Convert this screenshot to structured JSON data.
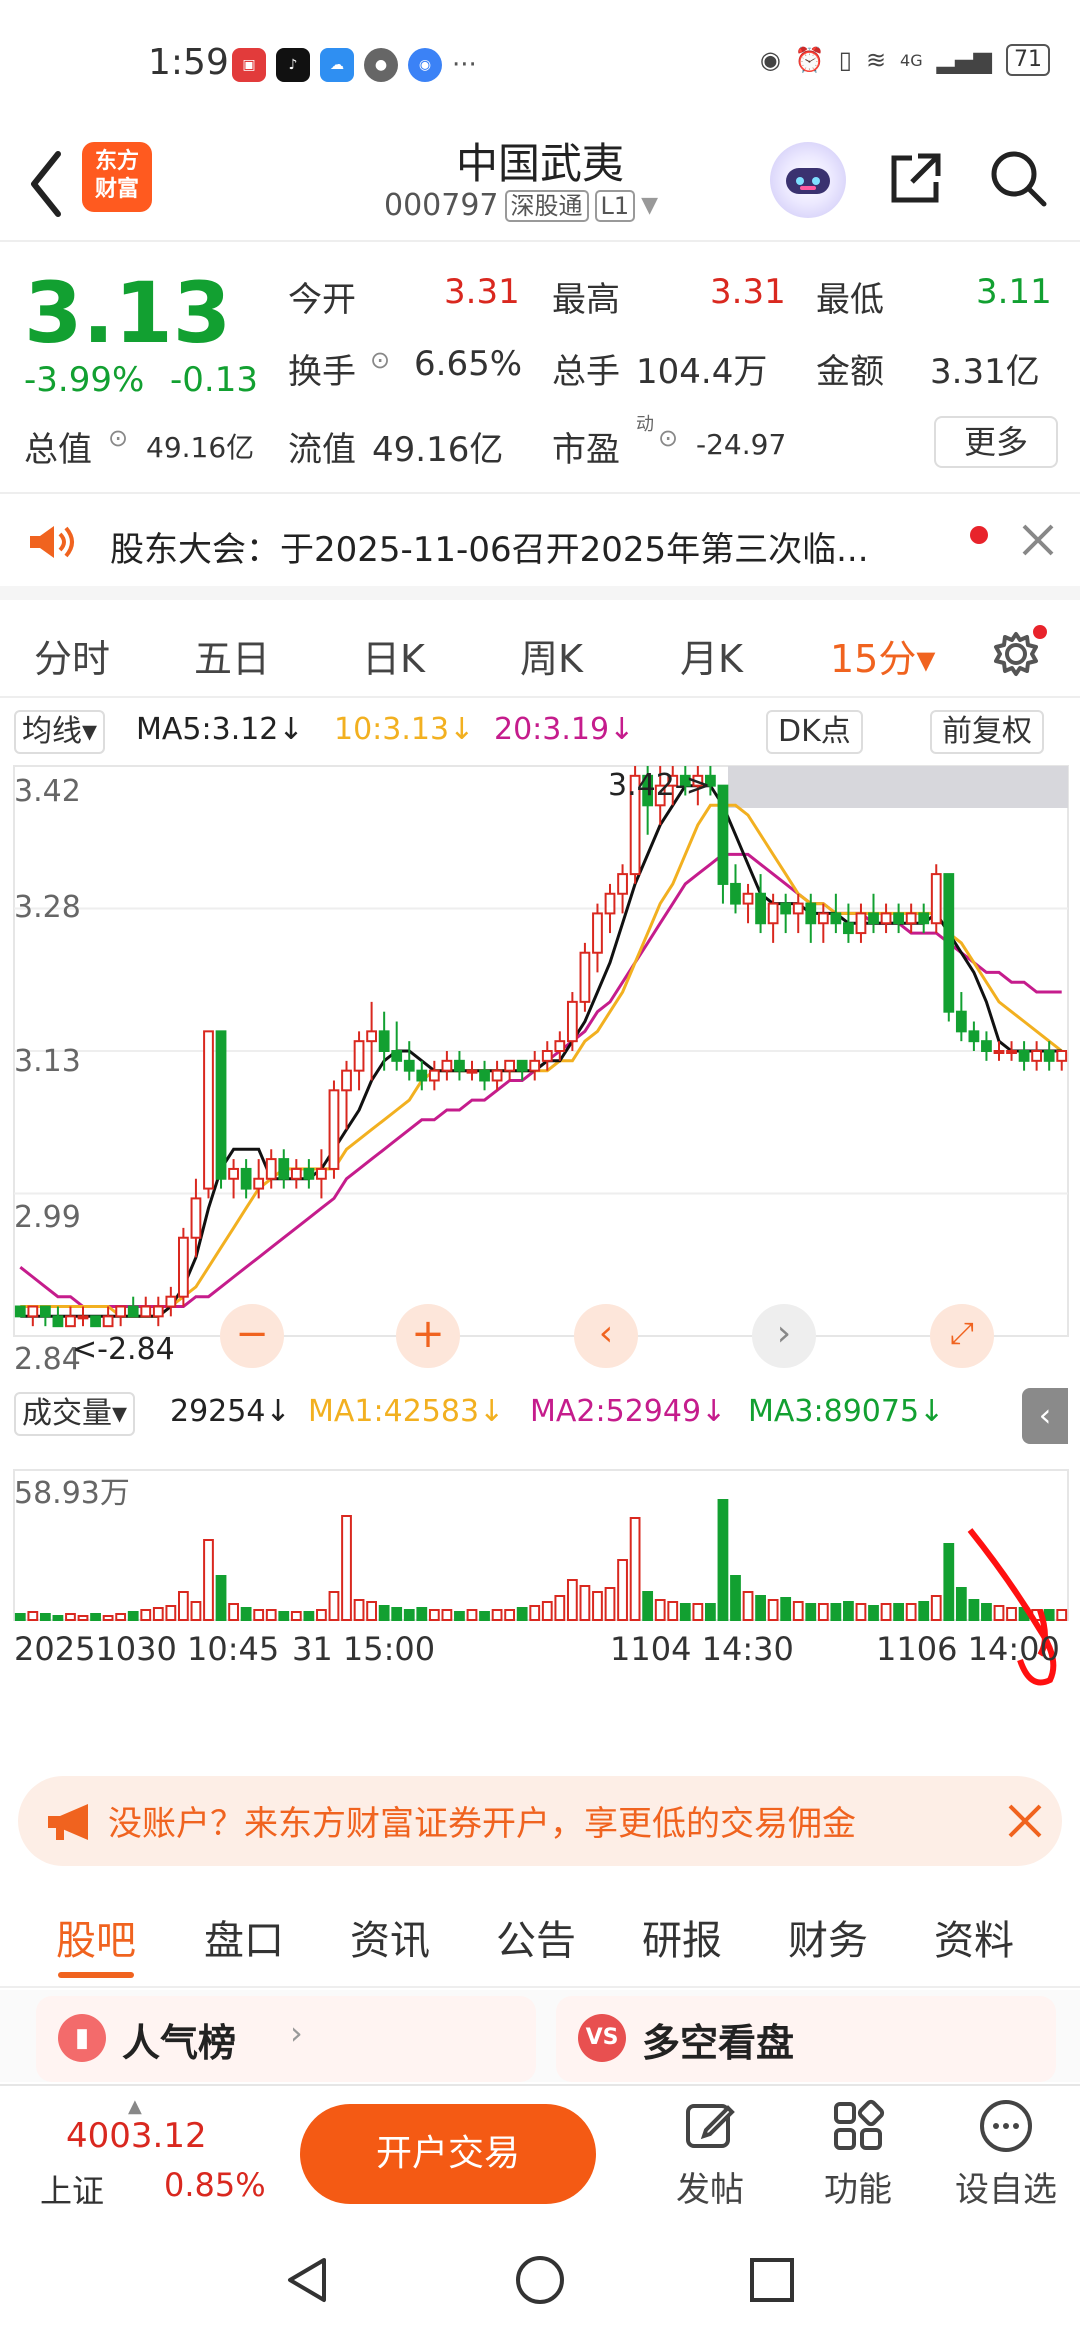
{
  "status_bar": {
    "time": "1:59",
    "network": "4G",
    "battery": "71"
  },
  "header": {
    "logo_line1": "东方",
    "logo_line2": "财富",
    "title": "中国武夷",
    "code": "000797",
    "tag1": "深股通",
    "tag2": "L1"
  },
  "quote": {
    "price": "3.13",
    "pct": "-3.99%",
    "change": "-0.13",
    "open_label": "今开",
    "open": "3.31",
    "high_label": "最高",
    "high": "3.31",
    "low_label": "最低",
    "low": "3.11",
    "turnover_label": "换手",
    "turnover": "6.65%",
    "volume_label": "总手",
    "volume": "104.4万",
    "amount_label": "金额",
    "amount": "3.31亿",
    "total_mv_label": "总值",
    "total_mv": "49.16亿",
    "float_mv_label": "流值",
    "float_mv": "49.16亿",
    "pe_label": "市盈",
    "pe_sup": "动",
    "pe": "-24.97",
    "more": "更多"
  },
  "notice": {
    "text": "股东大会：于2025-11-06召开2025年第三次临..."
  },
  "chart_tabs": [
    {
      "label": "分时"
    },
    {
      "label": "五日"
    },
    {
      "label": "日K"
    },
    {
      "label": "周K"
    },
    {
      "label": "月K"
    },
    {
      "label": "15分▾"
    }
  ],
  "ma_bar": {
    "selector": "均线▾",
    "ma5": "MA5:3.12↓",
    "ma10": "10:3.13↓",
    "ma20": "20:3.19↓",
    "dk": "DK点",
    "fq": "前复权"
  },
  "price_axis": [
    "3.42",
    "3.28",
    "3.13",
    "2.99",
    "2.84"
  ],
  "max_label": "3.42->",
  "min_label": "<-2.84",
  "vol_bar": {
    "selector": "成交量▾",
    "vol": "29254↓",
    "ma1": "MA1:42583↓",
    "ma2": "MA2:52949↓",
    "ma3": "MA3:89075↓"
  },
  "vol_axis": "58.93万",
  "time_axis": [
    "20251030 10:45",
    "31 15:00",
    "1104 14:30",
    "1106 14:00"
  ],
  "banner": {
    "text": "没账户？来东方财富证券开户，享更低的交易佣金"
  },
  "subtabs": [
    {
      "label": "股吧"
    },
    {
      "label": "盘口"
    },
    {
      "label": "资讯"
    },
    {
      "label": "公告"
    },
    {
      "label": "研报"
    },
    {
      "label": "财务"
    },
    {
      "label": "资料"
    }
  ],
  "cards": {
    "left": "人气榜",
    "right": "多空看盘"
  },
  "bottom": {
    "index_value": "4003.12",
    "index_name": "上证",
    "index_pct": "0.85%",
    "trade": "开户交易",
    "post": "发帖",
    "func": "功能",
    "watch": "设自选"
  },
  "colors": {
    "up": "#d9281f",
    "down": "#12a031",
    "accent": "#f0631f",
    "ma5": "#111111",
    "ma10": "#f2b020",
    "ma20": "#c51c8c"
  },
  "chart_data": {
    "type": "candlestick",
    "ylim": [
      2.84,
      3.42
    ],
    "candles": [
      [
        2.87,
        2.87,
        2.86,
        2.86
      ],
      [
        2.86,
        2.87,
        2.85,
        2.87
      ],
      [
        2.87,
        2.87,
        2.85,
        2.86
      ],
      [
        2.86,
        2.87,
        2.85,
        2.85
      ],
      [
        2.85,
        2.87,
        2.85,
        2.86
      ],
      [
        2.86,
        2.87,
        2.85,
        2.86
      ],
      [
        2.86,
        2.86,
        2.85,
        2.85
      ],
      [
        2.85,
        2.87,
        2.85,
        2.86
      ],
      [
        2.86,
        2.87,
        2.85,
        2.87
      ],
      [
        2.87,
        2.88,
        2.86,
        2.86
      ],
      [
        2.86,
        2.88,
        2.86,
        2.87
      ],
      [
        2.86,
        2.88,
        2.85,
        2.87
      ],
      [
        2.87,
        2.89,
        2.86,
        2.88
      ],
      [
        2.88,
        2.95,
        2.87,
        2.94
      ],
      [
        2.94,
        3.0,
        2.92,
        2.98
      ],
      [
        2.99,
        3.15,
        2.98,
        3.15
      ],
      [
        3.15,
        3.15,
        2.99,
        3.0
      ],
      [
        3.0,
        3.02,
        2.98,
        3.01
      ],
      [
        3.01,
        3.02,
        2.98,
        2.99
      ],
      [
        2.99,
        3.02,
        2.98,
        3.0
      ],
      [
        3.0,
        3.03,
        2.99,
        3.02
      ],
      [
        3.02,
        3.03,
        2.99,
        3.0
      ],
      [
        3.0,
        3.02,
        2.99,
        3.01
      ],
      [
        3.01,
        3.02,
        2.99,
        3.0
      ],
      [
        3.0,
        3.03,
        2.98,
        3.01
      ],
      [
        3.01,
        3.1,
        3.0,
        3.09
      ],
      [
        3.09,
        3.12,
        3.05,
        3.11
      ],
      [
        3.11,
        3.15,
        3.09,
        3.14
      ],
      [
        3.14,
        3.18,
        3.1,
        3.15
      ],
      [
        3.15,
        3.17,
        3.11,
        3.13
      ],
      [
        3.13,
        3.16,
        3.11,
        3.12
      ],
      [
        3.12,
        3.14,
        3.1,
        3.11
      ],
      [
        3.11,
        3.12,
        3.09,
        3.1
      ],
      [
        3.1,
        3.12,
        3.09,
        3.11
      ],
      [
        3.11,
        3.13,
        3.1,
        3.12
      ],
      [
        3.12,
        3.13,
        3.1,
        3.11
      ],
      [
        3.11,
        3.12,
        3.1,
        3.11
      ],
      [
        3.11,
        3.12,
        3.09,
        3.1
      ],
      [
        3.1,
        3.12,
        3.09,
        3.11
      ],
      [
        3.11,
        3.12,
        3.1,
        3.12
      ],
      [
        3.12,
        3.12,
        3.1,
        3.11
      ],
      [
        3.11,
        3.13,
        3.1,
        3.12
      ],
      [
        3.12,
        3.14,
        3.11,
        3.13
      ],
      [
        3.13,
        3.15,
        3.12,
        3.14
      ],
      [
        3.14,
        3.19,
        3.13,
        3.18
      ],
      [
        3.18,
        3.24,
        3.17,
        3.23
      ],
      [
        3.23,
        3.28,
        3.21,
        3.27
      ],
      [
        3.27,
        3.3,
        3.25,
        3.29
      ],
      [
        3.29,
        3.32,
        3.27,
        3.31
      ],
      [
        3.31,
        3.42,
        3.3,
        3.41
      ],
      [
        3.41,
        3.42,
        3.35,
        3.38
      ],
      [
        3.38,
        3.42,
        3.36,
        3.4
      ],
      [
        3.4,
        3.42,
        3.38,
        3.41
      ],
      [
        3.41,
        3.42,
        3.39,
        3.4
      ],
      [
        3.4,
        3.42,
        3.38,
        3.41
      ],
      [
        3.41,
        3.42,
        3.39,
        3.4
      ],
      [
        3.4,
        3.35,
        3.28,
        3.3
      ],
      [
        3.3,
        3.32,
        3.27,
        3.28
      ],
      [
        3.28,
        3.3,
        3.26,
        3.29
      ],
      [
        3.29,
        3.31,
        3.25,
        3.26
      ],
      [
        3.26,
        3.29,
        3.24,
        3.28
      ],
      [
        3.28,
        3.29,
        3.25,
        3.27
      ],
      [
        3.27,
        3.29,
        3.25,
        3.28
      ],
      [
        3.28,
        3.29,
        3.24,
        3.26
      ],
      [
        3.26,
        3.28,
        3.24,
        3.27
      ],
      [
        3.27,
        3.29,
        3.25,
        3.26
      ],
      [
        3.26,
        3.28,
        3.24,
        3.25
      ],
      [
        3.25,
        3.28,
        3.24,
        3.27
      ],
      [
        3.27,
        3.29,
        3.25,
        3.26
      ],
      [
        3.26,
        3.28,
        3.25,
        3.27
      ],
      [
        3.27,
        3.28,
        3.25,
        3.26
      ],
      [
        3.26,
        3.28,
        3.25,
        3.27
      ],
      [
        3.27,
        3.28,
        3.25,
        3.26
      ],
      [
        3.26,
        3.32,
        3.25,
        3.31
      ],
      [
        3.31,
        3.31,
        3.16,
        3.17
      ],
      [
        3.17,
        3.19,
        3.14,
        3.15
      ],
      [
        3.15,
        3.16,
        3.13,
        3.14
      ],
      [
        3.14,
        3.15,
        3.12,
        3.13
      ],
      [
        3.13,
        3.14,
        3.12,
        3.13
      ],
      [
        3.13,
        3.14,
        3.12,
        3.13
      ],
      [
        3.13,
        3.14,
        3.11,
        3.12
      ],
      [
        3.12,
        3.14,
        3.11,
        3.13
      ],
      [
        3.13,
        3.14,
        3.11,
        3.12
      ],
      [
        3.12,
        3.13,
        3.11,
        3.13
      ]
    ],
    "volumes": [
      3,
      4,
      3,
      2,
      3,
      2,
      3,
      2,
      3,
      4,
      5,
      6,
      7,
      14,
      9,
      40,
      22,
      8,
      6,
      5,
      5,
      4,
      4,
      4,
      5,
      14,
      52,
      10,
      9,
      7,
      6,
      5,
      6,
      5,
      5,
      4,
      5,
      4,
      5,
      5,
      6,
      7,
      9,
      12,
      20,
      17,
      14,
      16,
      30,
      51,
      14,
      10,
      9,
      8,
      8,
      8,
      60,
      22,
      14,
      12,
      10,
      11,
      9,
      8,
      8,
      8,
      9,
      8,
      7,
      8,
      8,
      8,
      9,
      12,
      38,
      16,
      10,
      8,
      7,
      6,
      6,
      5,
      5,
      5
    ],
    "ma5": [
      2.86,
      2.86,
      2.86,
      2.86,
      2.86,
      2.86,
      2.86,
      2.86,
      2.86,
      2.86,
      2.86,
      2.86,
      2.87,
      2.89,
      2.92,
      2.97,
      3.01,
      3.03,
      3.03,
      3.03,
      3.0,
      3.0,
      3.0,
      3.0,
      3.01,
      3.03,
      3.05,
      3.07,
      3.1,
      3.12,
      3.13,
      3.13,
      3.12,
      3.11,
      3.11,
      3.11,
      3.11,
      3.11,
      3.11,
      3.11,
      3.11,
      3.11,
      3.12,
      3.12,
      3.14,
      3.16,
      3.19,
      3.22,
      3.26,
      3.3,
      3.33,
      3.36,
      3.38,
      3.4,
      3.4,
      3.4,
      3.38,
      3.35,
      3.32,
      3.29,
      3.28,
      3.28,
      3.28,
      3.27,
      3.27,
      3.27,
      3.26,
      3.26,
      3.26,
      3.26,
      3.26,
      3.26,
      3.26,
      3.27,
      3.25,
      3.23,
      3.21,
      3.18,
      3.14,
      3.13,
      3.13,
      3.13,
      3.13,
      3.13
    ],
    "ma10": [
      2.87,
      2.87,
      2.87,
      2.87,
      2.87,
      2.87,
      2.87,
      2.87,
      2.86,
      2.86,
      2.86,
      2.86,
      2.87,
      2.88,
      2.89,
      2.91,
      2.93,
      2.95,
      2.97,
      2.99,
      3.0,
      3.01,
      3.01,
      3.01,
      3.01,
      3.01,
      3.03,
      3.04,
      3.05,
      3.06,
      3.07,
      3.08,
      3.1,
      3.11,
      3.11,
      3.11,
      3.11,
      3.11,
      3.11,
      3.11,
      3.11,
      3.11,
      3.11,
      3.12,
      3.12,
      3.14,
      3.15,
      3.17,
      3.19,
      3.22,
      3.25,
      3.28,
      3.3,
      3.33,
      3.36,
      3.38,
      3.38,
      3.38,
      3.37,
      3.35,
      3.33,
      3.31,
      3.29,
      3.28,
      3.28,
      3.27,
      3.27,
      3.27,
      3.27,
      3.27,
      3.27,
      3.27,
      3.27,
      3.27,
      3.25,
      3.24,
      3.22,
      3.2,
      3.18,
      3.17,
      3.16,
      3.15,
      3.14,
      3.13
    ],
    "ma20": [
      2.91,
      2.9,
      2.89,
      2.88,
      2.88,
      2.87,
      2.87,
      2.87,
      2.87,
      2.87,
      2.87,
      2.87,
      2.87,
      2.87,
      2.88,
      2.88,
      2.89,
      2.9,
      2.91,
      2.92,
      2.93,
      2.94,
      2.95,
      2.96,
      2.97,
      2.98,
      3.0,
      3.01,
      3.02,
      3.03,
      3.04,
      3.05,
      3.06,
      3.06,
      3.07,
      3.07,
      3.08,
      3.08,
      3.09,
      3.1,
      3.1,
      3.11,
      3.12,
      3.13,
      3.14,
      3.15,
      3.17,
      3.18,
      3.2,
      3.22,
      3.24,
      3.26,
      3.28,
      3.3,
      3.31,
      3.32,
      3.33,
      3.33,
      3.33,
      3.32,
      3.31,
      3.3,
      3.29,
      3.28,
      3.28,
      3.27,
      3.27,
      3.27,
      3.26,
      3.26,
      3.26,
      3.25,
      3.25,
      3.25,
      3.24,
      3.23,
      3.22,
      3.21,
      3.21,
      3.2,
      3.2,
      3.19,
      3.19,
      3.19
    ]
  }
}
